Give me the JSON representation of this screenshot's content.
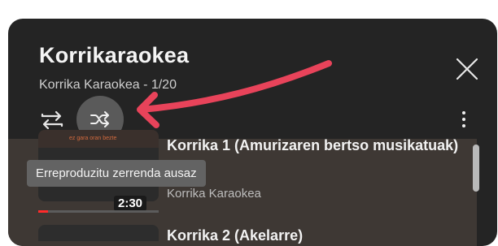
{
  "playlist": {
    "title": "Korrikaraokea",
    "subtitle": "Korrika Karaokea - 1/20"
  },
  "controls": {
    "repeat_icon": "repeat-icon",
    "shuffle_icon": "shuffle-icon",
    "close_icon": "close-icon",
    "more_icon": "more-vertical-icon"
  },
  "tooltip": {
    "text": "Erreproduzitu zerrenda ausaz"
  },
  "annotation": {
    "arrow_color": "#e8435a"
  },
  "items": [
    {
      "title": "Korrika 1 (Amurizaren bertso musikatuak)",
      "artist": "Korrika Karaokea",
      "duration": "2:30",
      "progress": 0.08,
      "thumb_caption": "ez gara oran bezte"
    },
    {
      "title": "Korrika 2 (Akelarre)"
    }
  ],
  "colors": {
    "panel": "#242424",
    "active_row": "#3e3834",
    "progress": "#ff2b2b"
  }
}
